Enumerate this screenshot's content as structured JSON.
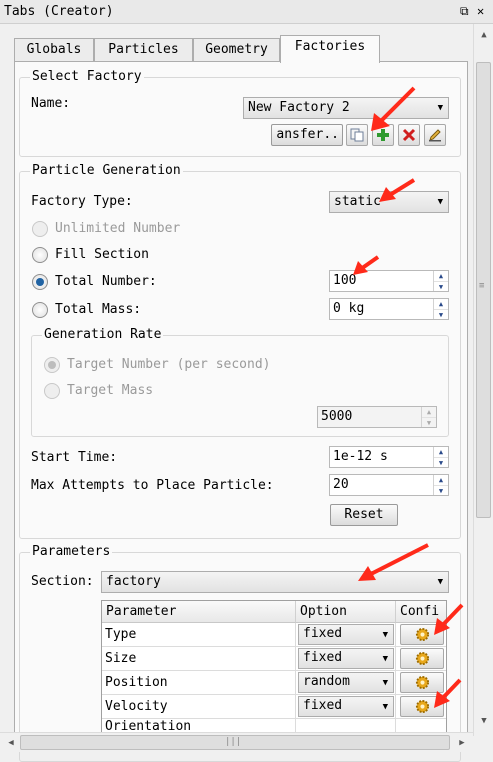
{
  "window": {
    "title": "Tabs (Creator)",
    "float_glyph": "⧉",
    "close_glyph": "✕"
  },
  "tabs": [
    {
      "label": "Globals"
    },
    {
      "label": "Particles"
    },
    {
      "label": "Geometry"
    },
    {
      "label": "Factories"
    }
  ],
  "select_factory": {
    "title": "Select Factory",
    "name_label": "Name:",
    "name_value": "New Factory 2",
    "transfer_label": "ansfer..",
    "icons": [
      "copy-icon",
      "add-icon",
      "delete-icon",
      "edit-icon"
    ]
  },
  "particle_generation": {
    "title": "Particle Generation",
    "factory_type_label": "Factory Type:",
    "factory_type_value": "static",
    "unlimited_label": "Unlimited Number",
    "fill_label": "Fill Section",
    "total_number_label": "Total Number:",
    "total_number_value": "100",
    "total_mass_label": "Total Mass:",
    "total_mass_value": "0 kg",
    "selected_mode": "Total Number",
    "rate": {
      "title": "Generation Rate",
      "target_number_label": "Target Number (per second)",
      "target_mass_label": "Target Mass",
      "value": "5000"
    },
    "start_time_label": "Start Time:",
    "start_time_value": "1e-12 s",
    "max_attempts_label": "Max Attempts to Place Particle:",
    "max_attempts_value": "20",
    "reset_label": "Reset"
  },
  "parameters": {
    "title": "Parameters",
    "section_label": "Section:",
    "section_value": "factory",
    "headers": [
      "Parameter",
      "Option",
      "Confi"
    ],
    "rows": [
      {
        "parameter": "Type",
        "option": "fixed"
      },
      {
        "parameter": "Size",
        "option": "fixed"
      },
      {
        "parameter": "Position",
        "option": "random"
      },
      {
        "parameter": "Velocity",
        "option": "fixed"
      }
    ],
    "partial_row": "Orientation"
  },
  "colors": {
    "annotation_arrow": "#ff2a1a",
    "selection_accent": "#2163a3",
    "gear": "#e8a81c"
  }
}
